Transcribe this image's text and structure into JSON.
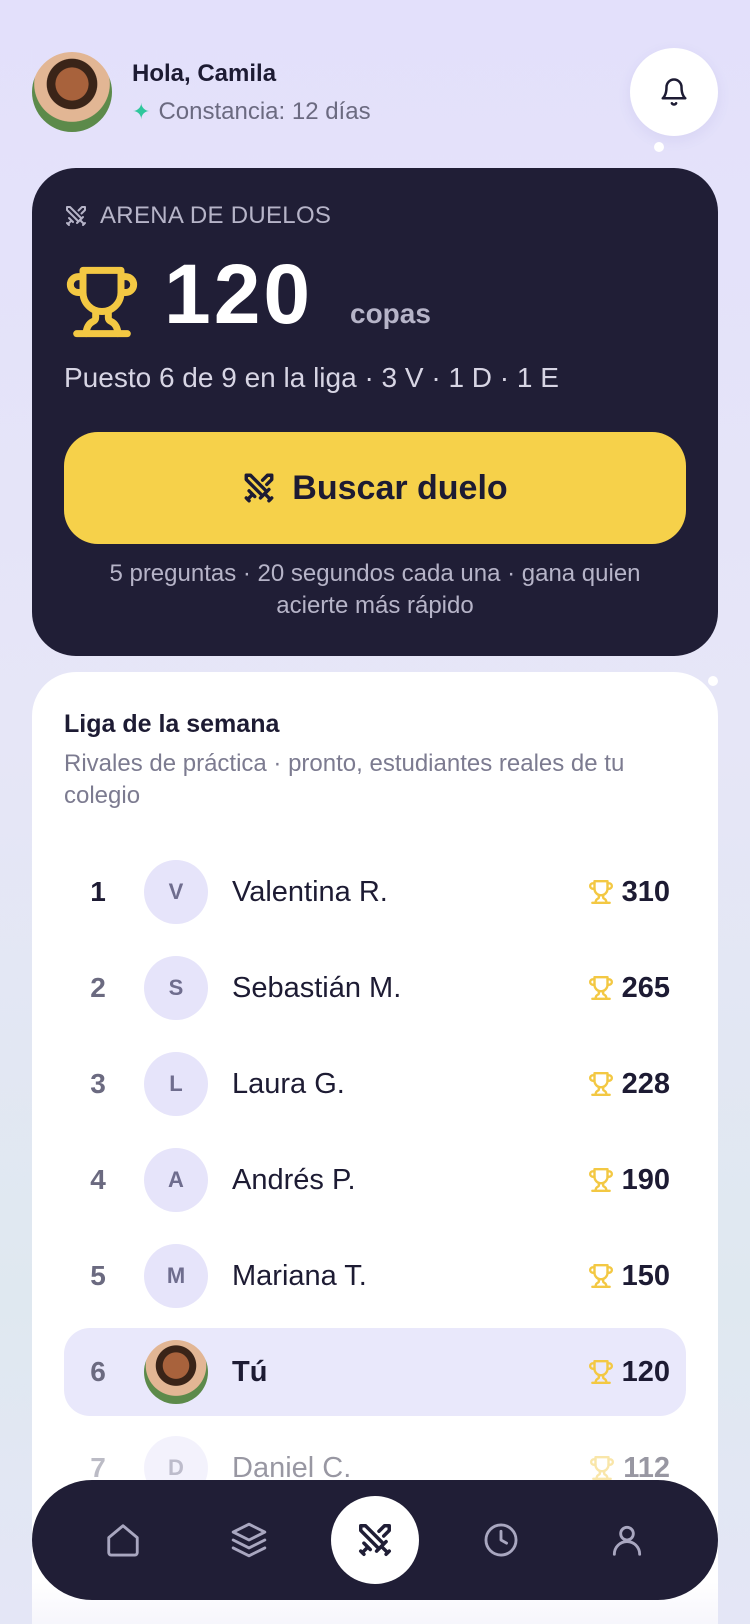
{
  "header": {
    "greeting": "Hola, Camila",
    "streak": "Constancia: 12 días",
    "notifications_icon": "bell-icon"
  },
  "arena": {
    "label": "ARENA DE DUELOS",
    "cups": "120",
    "cups_unit": "copas",
    "standing": "Puesto 6 de 9 en la liga · 3 V · 1 D · 1 E",
    "search_button": "Buscar duelo",
    "rules": "5 preguntas · 20 segundos cada una · gana quien acierte más rápido"
  },
  "league": {
    "title": "Liga de la semana",
    "subtitle": "Rivales de práctica · pronto, estudiantes reales de tu colegio",
    "rows": [
      {
        "pos": "1",
        "initial": "V",
        "name": "Valentina R.",
        "score": "310"
      },
      {
        "pos": "2",
        "initial": "S",
        "name": "Sebastián M.",
        "score": "265"
      },
      {
        "pos": "3",
        "initial": "L",
        "name": "Laura G.",
        "score": "228"
      },
      {
        "pos": "4",
        "initial": "A",
        "name": "Andrés P.",
        "score": "190"
      },
      {
        "pos": "5",
        "initial": "M",
        "name": "Mariana T.",
        "score": "150"
      },
      {
        "pos": "6",
        "initial": "",
        "name": "Tú",
        "score": "120"
      },
      {
        "pos": "7",
        "initial": "D",
        "name": "Daniel C.",
        "score": "112"
      }
    ]
  },
  "nav": {
    "items": [
      "home-icon",
      "layers-icon",
      "swords-icon",
      "clock-icon",
      "profile-icon"
    ],
    "active": "swords-icon"
  },
  "colors": {
    "dark": "#201e36",
    "accent_yellow": "#f6d14a",
    "trophy": "#f3c843",
    "streak": "#2fc79c",
    "highlight_row": "#e9e8fb"
  }
}
